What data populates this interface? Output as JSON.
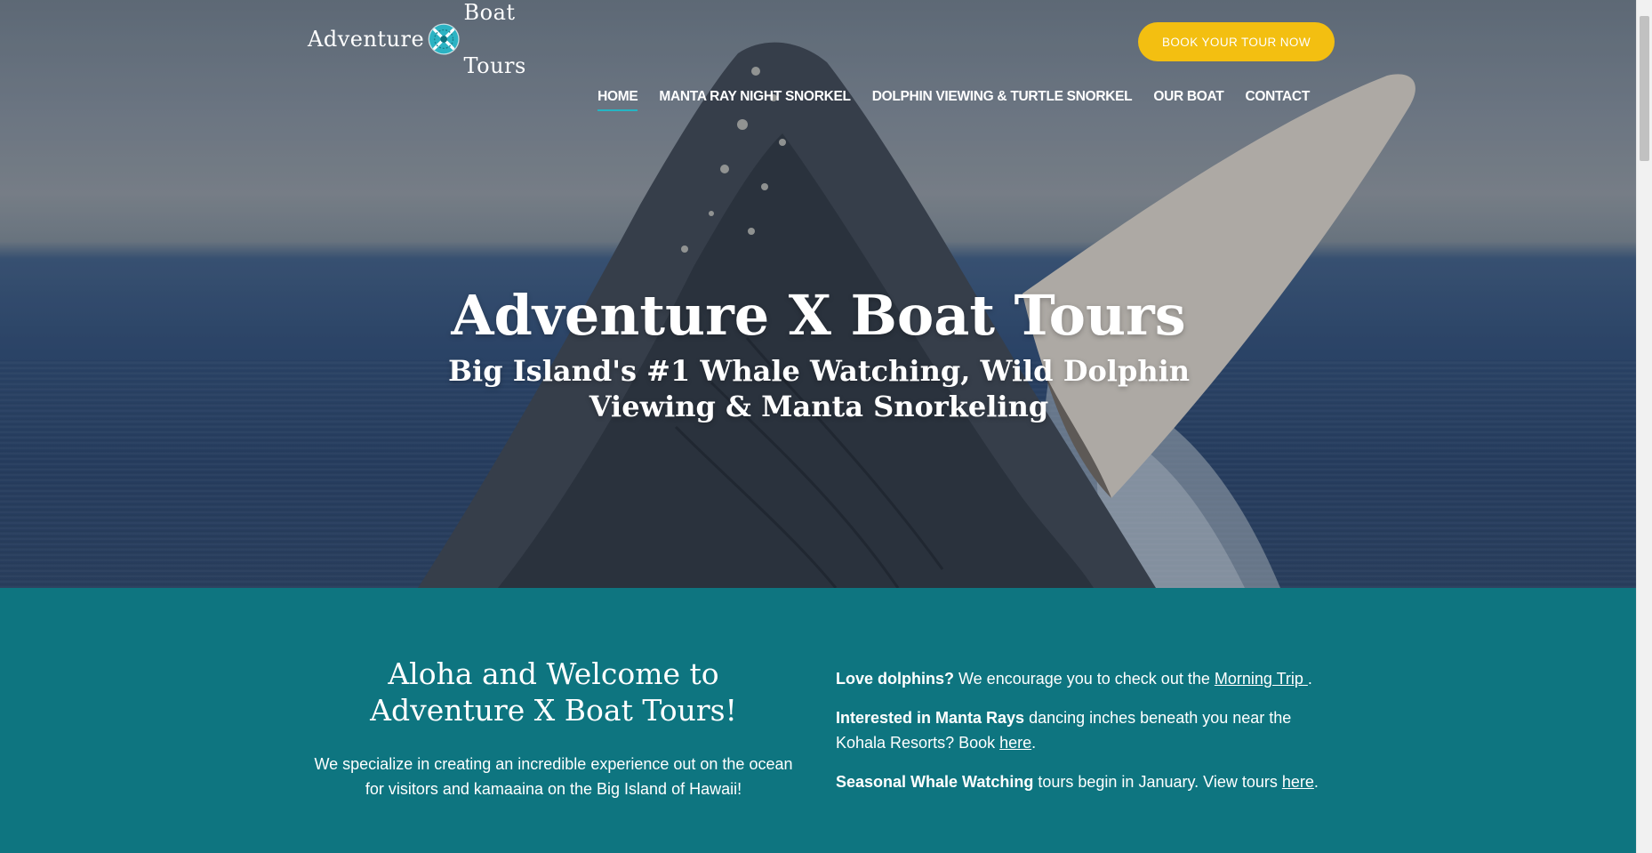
{
  "header": {
    "logo": {
      "word_left": "Adventure",
      "word_right": "Boat Tours",
      "icon": "x-emblem-icon"
    },
    "book_button": "BOOK YOUR TOUR NOW",
    "nav": [
      {
        "label": "HOME",
        "active": true
      },
      {
        "label": "MANTA RAY NIGHT SNORKEL",
        "active": false
      },
      {
        "label": "DOLPHIN VIEWING & TURTLE SNORKEL",
        "active": false
      },
      {
        "label": "OUR BOAT",
        "active": false
      },
      {
        "label": "CONTACT",
        "active": false
      }
    ]
  },
  "hero": {
    "title": "Adventure X Boat Tours",
    "subtitle": "Big Island's #1 Whale Watching, Wild Dolphin Viewing & Manta Snorkeling"
  },
  "welcome": {
    "heading": "Aloha and Welcome to Adventure X Boat Tours!",
    "body": "We specialize in creating an incredible experience out on the ocean for visitors and kamaaina on the Big Island of Hawaii!"
  },
  "info": [
    {
      "bold": "Love dolphins?",
      "text": " We encourage you to check out the ",
      "link": "Morning Trip ",
      "after": "."
    },
    {
      "bold": "Interested in Manta Rays",
      "text": " dancing inches beneath you near the Kohala Resorts? Book ",
      "link": "here",
      "after": "."
    },
    {
      "bold": "Seasonal Whale Watching",
      "text": " tours begin in January. View tours ",
      "link": "here",
      "after": "."
    }
  ],
  "colors": {
    "teal": "#0e7580",
    "accent_yellow": "#f3bf11",
    "nav_underline": "#25b5c4"
  }
}
